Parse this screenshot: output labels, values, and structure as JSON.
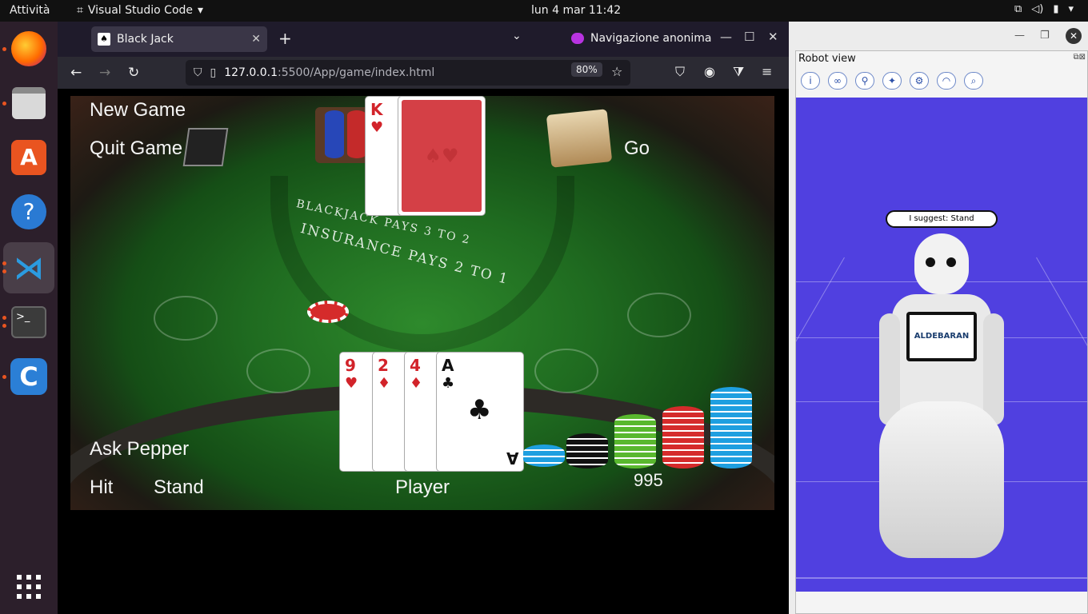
{
  "topbar": {
    "activities": "Attività",
    "app_name": "Visual Studio Code",
    "clock": "lun 4 mar  11:42"
  },
  "dock": {
    "items": [
      "firefox-icon",
      "files-icon",
      "app-center-icon",
      "help-icon",
      "vscode-icon",
      "terminal-icon",
      "app-c-icon",
      "show-apps-icon"
    ]
  },
  "browser": {
    "tab_title": "Black Jack",
    "private_label": "Navigazione anonima",
    "url_host": "127.0.0.1",
    "url_rest": ":5500/App/game/index.html",
    "zoom": "80%"
  },
  "game": {
    "new_game": "New Game",
    "quit_game": "Quit Game",
    "go": "Go",
    "ask_pepper": "Ask Pepper",
    "hit": "Hit",
    "stand": "Stand",
    "player_label": "Player",
    "chips": "995",
    "table_pays": "BLACKJACK PAYS 3 TO 2",
    "table_insurance": "INSURANCE PAYS 2 TO 1",
    "dealer_cards": [
      {
        "rank": "K",
        "suit": "♥",
        "color": "red"
      }
    ],
    "player_cards": [
      {
        "rank": "9",
        "suit": "♥",
        "color": "red"
      },
      {
        "rank": "2",
        "suit": "♦",
        "color": "red"
      },
      {
        "rank": "4",
        "suit": "♦",
        "color": "red"
      },
      {
        "rank": "A",
        "suit": "♣",
        "color": "black"
      }
    ]
  },
  "robot": {
    "window_title": "Robot view",
    "suggestion": "I suggest: Stand",
    "tablet_logo": "ALDEBARAN",
    "scene_color": "#5040e0"
  }
}
